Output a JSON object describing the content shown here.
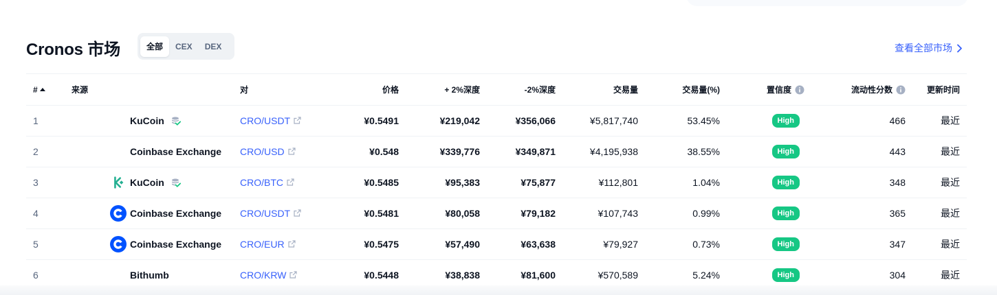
{
  "header": {
    "title": "Cronos 市场",
    "tabs": [
      {
        "label": "全部",
        "active": true
      },
      {
        "label": "CEX",
        "active": false
      },
      {
        "label": "DEX",
        "active": false
      }
    ],
    "view_all": "查看全部市场"
  },
  "columns": {
    "rank": "#",
    "source": "来源",
    "pair": "对",
    "price": "价格",
    "depth_plus": "+ 2%深度",
    "depth_minus": "-2%深度",
    "volume": "交易量",
    "volume_pct": "交易量(%)",
    "confidence": "置信度",
    "liquidity": "流动性分数",
    "updated": "更新时间"
  },
  "rows": [
    {
      "rank": "1",
      "exchange": "KuCoin",
      "logo": "none",
      "verified": true,
      "pair": "CRO/USDT",
      "price": "¥0.5491",
      "depth_plus": "¥219,042",
      "depth_minus": "¥356,066",
      "volume": "¥5,817,740",
      "volume_pct": "53.45%",
      "confidence": "High",
      "liquidity": "466",
      "updated": "最近"
    },
    {
      "rank": "2",
      "exchange": "Coinbase Exchange",
      "logo": "none",
      "verified": false,
      "pair": "CRO/USD",
      "price": "¥0.548",
      "depth_plus": "¥339,776",
      "depth_minus": "¥349,871",
      "volume": "¥4,195,938",
      "volume_pct": "38.55%",
      "confidence": "High",
      "liquidity": "443",
      "updated": "最近"
    },
    {
      "rank": "3",
      "exchange": "KuCoin",
      "logo": "kucoin-logo",
      "verified": true,
      "pair": "CRO/BTC",
      "price": "¥0.5485",
      "depth_plus": "¥95,383",
      "depth_minus": "¥75,877",
      "volume": "¥112,801",
      "volume_pct": "1.04%",
      "confidence": "High",
      "liquidity": "348",
      "updated": "最近"
    },
    {
      "rank": "4",
      "exchange": "Coinbase Exchange",
      "logo": "coinbase-logo",
      "verified": false,
      "pair": "CRO/USDT",
      "price": "¥0.5481",
      "depth_plus": "¥80,058",
      "depth_minus": "¥79,182",
      "volume": "¥107,743",
      "volume_pct": "0.99%",
      "confidence": "High",
      "liquidity": "365",
      "updated": "最近"
    },
    {
      "rank": "5",
      "exchange": "Coinbase Exchange",
      "logo": "coinbase-logo",
      "verified": false,
      "pair": "CRO/EUR",
      "price": "¥0.5475",
      "depth_plus": "¥57,490",
      "depth_minus": "¥63,638",
      "volume": "¥79,927",
      "volume_pct": "0.73%",
      "confidence": "High",
      "liquidity": "347",
      "updated": "最近"
    },
    {
      "rank": "6",
      "exchange": "Bithumb",
      "logo": "none",
      "verified": false,
      "pair": "CRO/KRW",
      "price": "¥0.5448",
      "depth_plus": "¥38,838",
      "depth_minus": "¥81,600",
      "volume": "¥570,589",
      "volume_pct": "5.24%",
      "confidence": "High",
      "liquidity": "304",
      "updated": "最近"
    }
  ],
  "colors": {
    "link": "#3861fb",
    "high_badge": "#16c784",
    "muted_text": "#58667e"
  }
}
